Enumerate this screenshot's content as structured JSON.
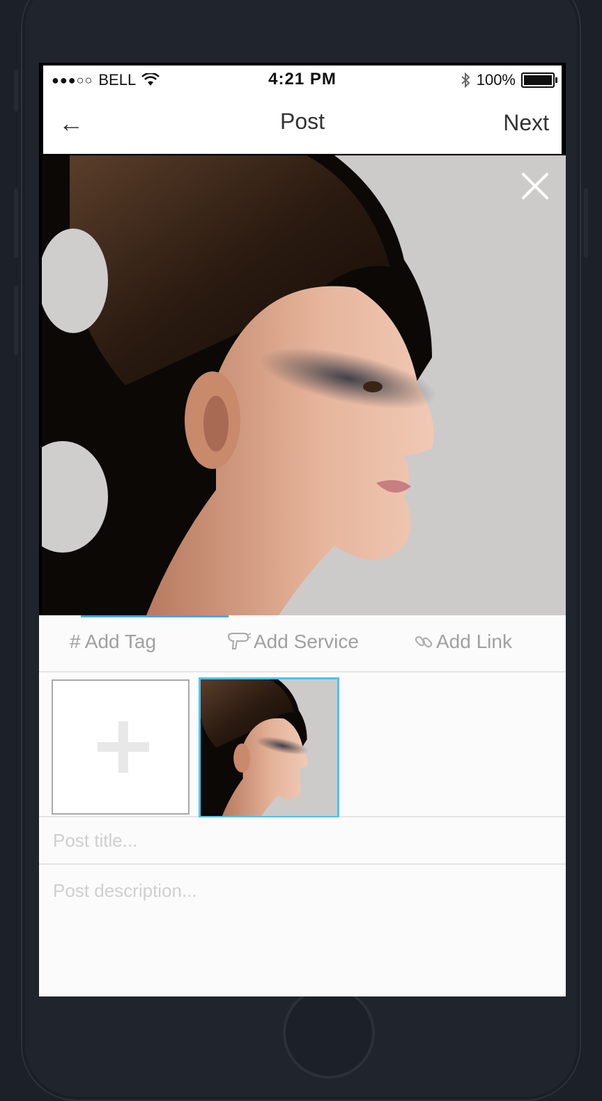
{
  "status_bar": {
    "signal": "●●●○○",
    "carrier": "BELL",
    "time": "4:21 PM",
    "battery_percent": "100%",
    "battery_level": 1.0
  },
  "nav": {
    "back_icon": "←",
    "title": "Post",
    "next_label": "Next"
  },
  "tabs": {
    "tag_label": "# Add Tag",
    "service_label": "Add Service",
    "link_label": "Add Link",
    "active_tab": "Add Tag"
  },
  "form": {
    "title_placeholder": "Post title...",
    "description_placeholder": "Post description..."
  },
  "colors": {
    "accent": "#4fc3ee",
    "tab_indicator": "#4aa6d8",
    "placeholder": "#cfcfcf"
  },
  "icons": [
    "back-arrow-icon",
    "close-icon",
    "wifi-icon",
    "bluetooth-icon",
    "battery-icon",
    "hair-dryer-icon",
    "link-icon",
    "plus-icon"
  ]
}
